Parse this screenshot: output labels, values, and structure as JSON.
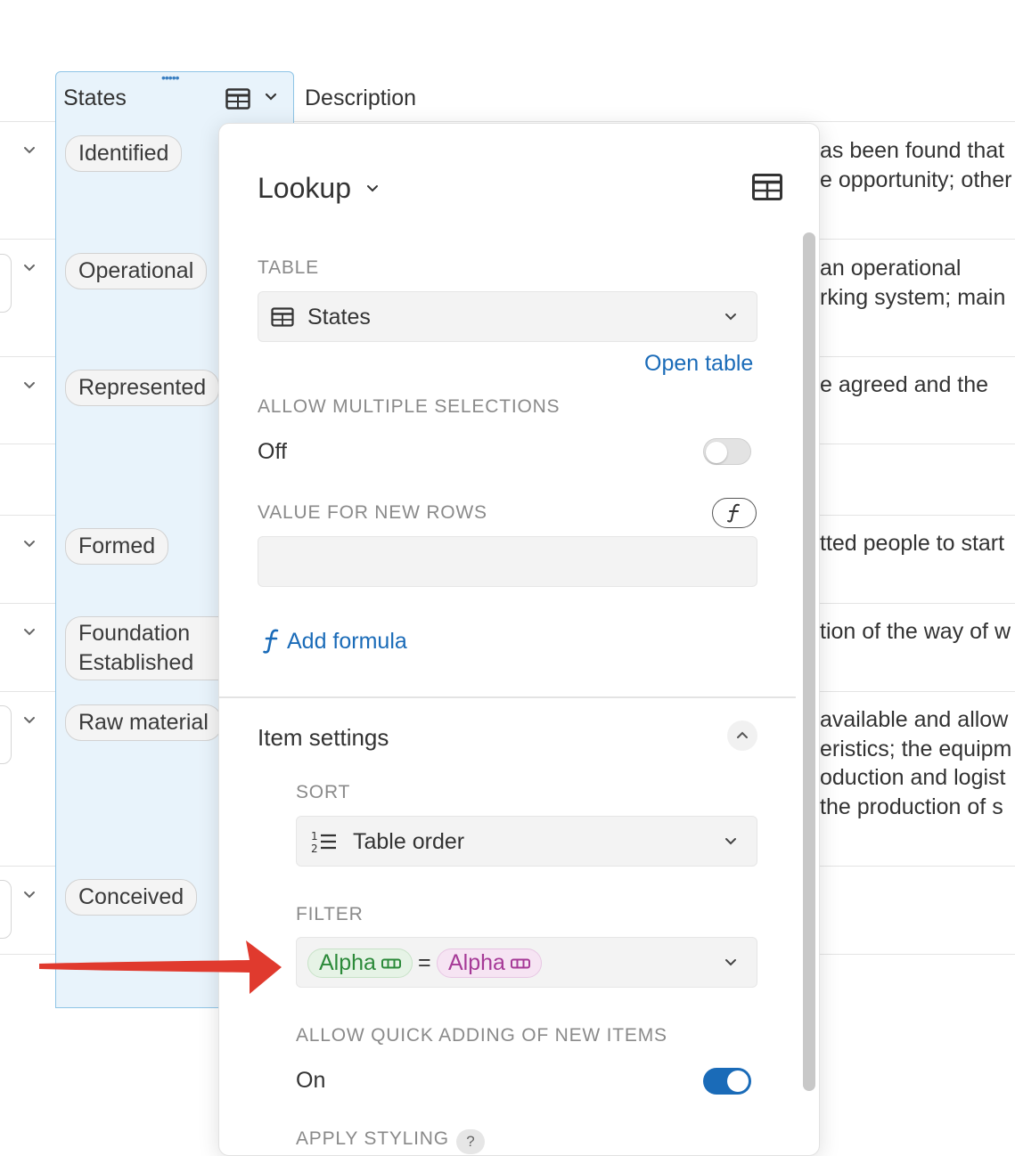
{
  "table": {
    "headers": {
      "states": "States",
      "description": "Description"
    },
    "rows": [
      {
        "state": "Identified",
        "desc_line1": "as been found that",
        "desc_line2": "e opportunity; other"
      },
      {
        "state": "Operational",
        "desc_line1": "an operational",
        "desc_line2": "rking system; main"
      },
      {
        "state": "Represented",
        "desc_line1": "e agreed and the",
        "desc_line2": ""
      },
      {
        "state": "",
        "desc_line1": "",
        "desc_line2": ""
      },
      {
        "state": "Formed",
        "desc_line1": "tted people to start",
        "desc_line2": ""
      },
      {
        "state": "Foundation Established",
        "desc_line1": "tion of the way of w",
        "desc_line2": ""
      },
      {
        "state": "Raw material",
        "desc_line1": "available and allow",
        "desc_line2": "eristics; the equipm",
        "desc_line3": "oduction and logist",
        "desc_line4": "the production of s"
      },
      {
        "state": "Conceived",
        "desc_line1": "",
        "desc_line2": ""
      }
    ]
  },
  "panel": {
    "title": "Lookup",
    "table_label": "TABLE",
    "table_value": "States",
    "open_table": "Open table",
    "allow_multiple_label": "ALLOW MULTIPLE SELECTIONS",
    "allow_multiple_state": "Off",
    "value_new_rows_label": "VALUE FOR NEW ROWS",
    "value_new_rows_value": "",
    "add_formula": "Add formula",
    "item_settings": "Item settings",
    "sort_label": "SORT",
    "sort_value": "Table order",
    "filter_label": "FILTER",
    "filter_left": "Alpha",
    "filter_op": "=",
    "filter_right": "Alpha",
    "quick_add_label": "ALLOW QUICK ADDING OF NEW ITEMS",
    "quick_add_state": "On",
    "apply_styling_label": "APPLY STYLING",
    "help": "?"
  },
  "colors": {
    "accent": "#1a6bb8",
    "column_highlight": "#e8f3fb",
    "arrow": "#e03a2e",
    "filter_left": "#2c8a3a",
    "filter_right": "#a63a97"
  }
}
